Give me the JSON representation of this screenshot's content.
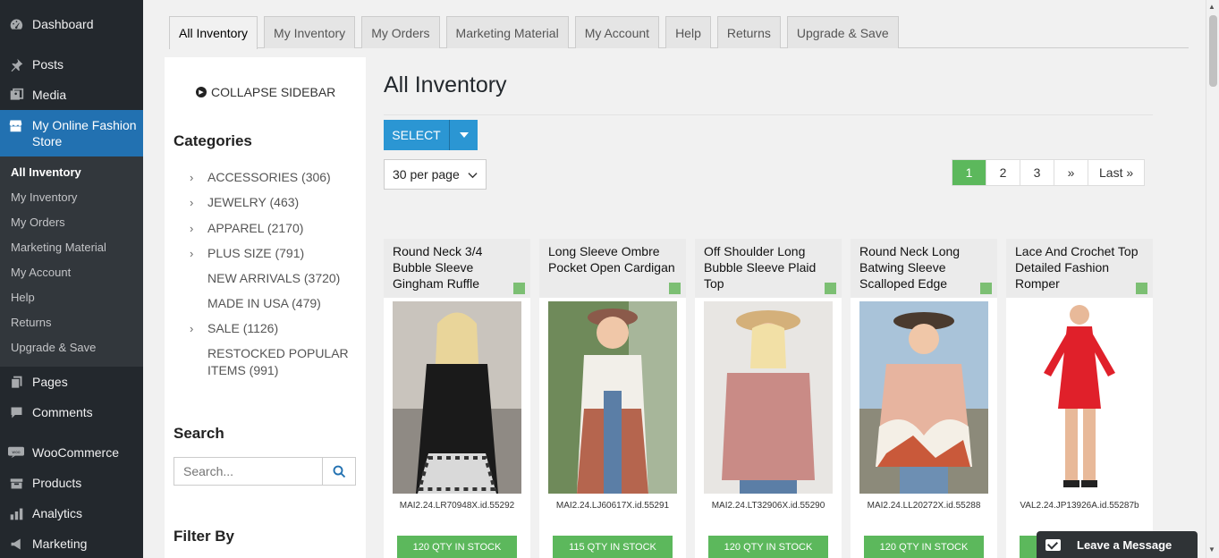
{
  "wp_menu": {
    "items": [
      {
        "label": "Dashboard",
        "icon": "dashboard-icon"
      },
      {
        "label": "Posts",
        "icon": "pin-icon"
      },
      {
        "label": "Media",
        "icon": "media-icon"
      },
      {
        "label": "My Online Fashion Store",
        "icon": "store-icon"
      }
    ],
    "submenu": [
      "All Inventory",
      "My Inventory",
      "My Orders",
      "Marketing Material",
      "My Account",
      "Help",
      "Returns",
      "Upgrade & Save"
    ],
    "items_after": [
      {
        "label": "Pages",
        "icon": "pages-icon"
      },
      {
        "label": "Comments",
        "icon": "comments-icon"
      },
      {
        "label": "WooCommerce",
        "icon": "woo-icon"
      },
      {
        "label": "Products",
        "icon": "products-icon"
      },
      {
        "label": "Analytics",
        "icon": "analytics-icon"
      },
      {
        "label": "Marketing",
        "icon": "marketing-icon"
      }
    ]
  },
  "tabs": [
    "All Inventory",
    "My Inventory",
    "My Orders",
    "Marketing Material",
    "My Account",
    "Help",
    "Returns",
    "Upgrade & Save"
  ],
  "sidebar": {
    "collapse_label": "COLLAPSE SIDEBAR",
    "categories_heading": "Categories",
    "categories": [
      {
        "label": "ACCESSORIES (306)",
        "expandable": true
      },
      {
        "label": "JEWELRY (463)",
        "expandable": true
      },
      {
        "label": "APPAREL (2170)",
        "expandable": true
      },
      {
        "label": "PLUS SIZE (791)",
        "expandable": true
      },
      {
        "label": "NEW ARRIVALS (3720)",
        "expandable": false
      },
      {
        "label": "MADE IN USA (479)",
        "expandable": false
      },
      {
        "label": "SALE (1126)",
        "expandable": true
      },
      {
        "label": "RESTOCKED POPULAR ITEMS (991)",
        "expandable": false
      }
    ],
    "search_heading": "Search",
    "search_placeholder": "Search...",
    "filter_heading": "Filter By"
  },
  "content": {
    "title": "All Inventory",
    "select_label": "SELECT",
    "per_page": "30 per page",
    "pagination": [
      "1",
      "2",
      "3",
      "»",
      "Last »"
    ],
    "current_page": "1"
  },
  "products": [
    {
      "name": "Round Neck 3/4 Bubble Sleeve Gingham Ruffle",
      "sku": "MAI2.24.LR70948X.id.55292",
      "stock": "120 QTY IN STOCK"
    },
    {
      "name": "Long Sleeve Ombre Pocket Open Cardigan",
      "sku": "MAI2.24.LJ60617X.id.55291",
      "stock": "115 QTY IN STOCK"
    },
    {
      "name": "Off Shoulder Long Bubble Sleeve Plaid Top",
      "sku": "MAI2.24.LT32906X.id.55290",
      "stock": "120 QTY IN STOCK"
    },
    {
      "name": "Round Neck Long Batwing Sleeve Scalloped Edge",
      "sku": "MAI2.24.LL20272X.id.55288",
      "stock": "120 QTY IN STOCK"
    },
    {
      "name": "Lace And Crochet Top Detailed Fashion Romper",
      "sku": "VAL2.24.JP13926A.id.55287b",
      "stock": ""
    }
  ],
  "chat": {
    "label": "Leave a Message"
  },
  "colors": {
    "wp_dark": "#23282d",
    "wp_active": "#2271b1",
    "select_blue": "#2b96d3",
    "stock_green": "#5cb85c"
  }
}
